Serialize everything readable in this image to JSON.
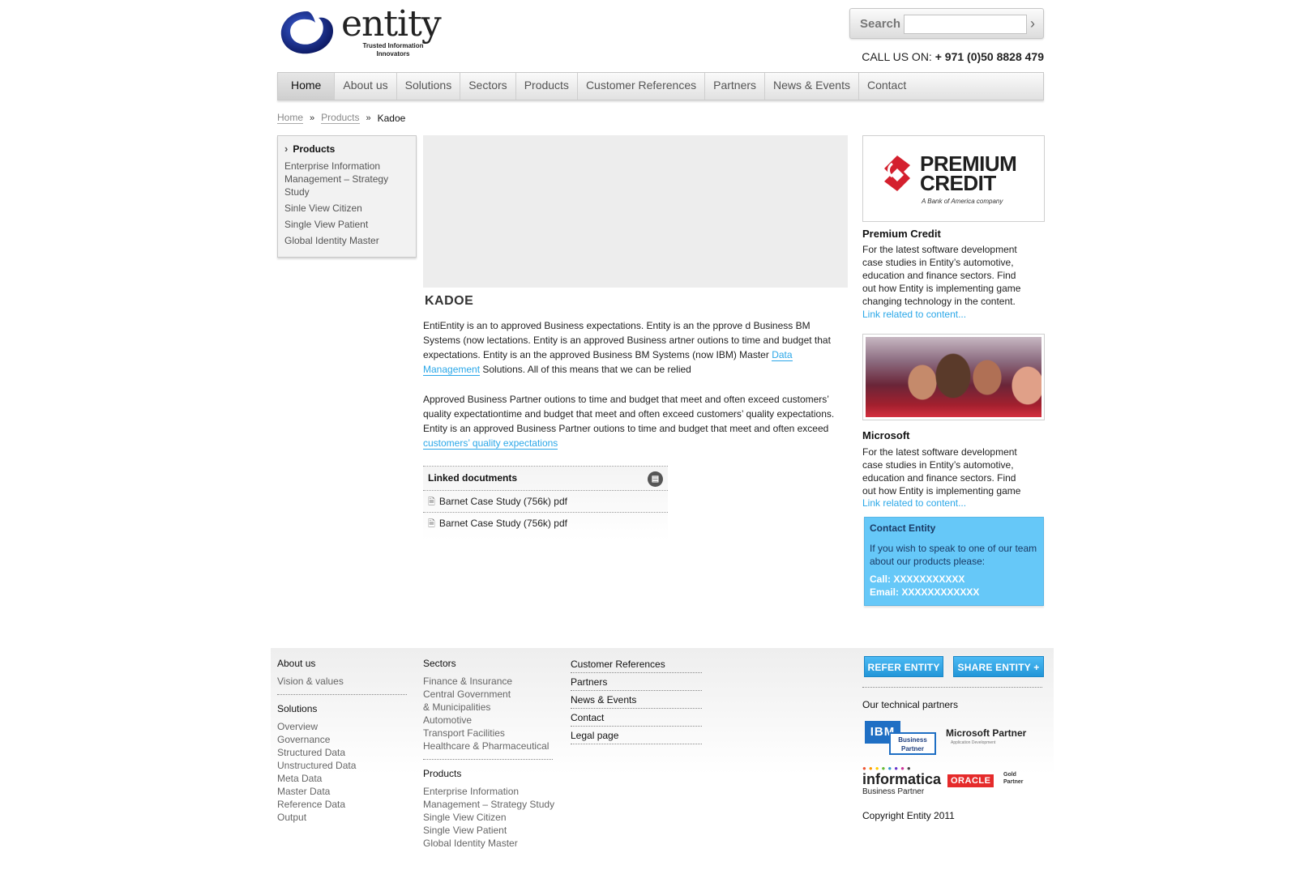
{
  "header": {
    "logo_word": "entity",
    "logo_tagline": "Trusted Information Innovators",
    "search_label": "Search",
    "search_placeholder": "",
    "call_prefix": "CALL US ON:",
    "call_number": "+ 971 (0)50 8828 479"
  },
  "nav": {
    "items": [
      "Home",
      "About us",
      "Solutions",
      "Sectors",
      "Products",
      "Customer References",
      "Partners",
      "News & Events",
      "Contact"
    ],
    "active": "Home"
  },
  "breadcrumb": {
    "home": "Home",
    "products": "Products",
    "current": "Kadoe"
  },
  "sidebar": {
    "title": "Products",
    "items": [
      "Enterprise Information Management – Strategy Study",
      "Sinle View Citizen",
      "Single View Patient",
      "Global Identity Master"
    ]
  },
  "main": {
    "title": "KADOE",
    "para1_a": "EntiEntity is an to  approved Business expectations. Entity is an the  pprove d Business BM Systems (now lectations. Entity is an  approved Business artner outions to time and budget that expectations. Entity is an the  approved Business BM Systems (now IBM) Master ",
    "para1_link": "Data Management",
    "para1_b": " Solutions. All of this means that we can be relied",
    "para2_a": "Approved Business Partner outions to time and budget that meet and often exceed customers’ quality expectationtime and budget that meet and often exceed customers’ quality expectations. Entity is an  approved Business Partner outions to time and budget that meet and often exceed ",
    "para2_link": "customers’ quality expectations",
    "docs_title": "Linked docutments",
    "docs": [
      "Barnet Case Study (756k) pdf",
      "Barnet Case Study (756k) pdf"
    ]
  },
  "right": {
    "pc_logo_line1": "PREMIUM",
    "pc_logo_line2": "CREDIT",
    "pc_logo_sub": "A Bank of America company",
    "card1_title": "Premium Credit",
    "card1_text": "For the latest software development case studies in Entity’s automotive, education and finance sectors. Find out how Entity is implementing game changing technology in the content.",
    "card1_link": "Link related to content...",
    "card2_title": "Microsoft",
    "card2_text": "For the latest software development case studies in Entity’s automotive, education and finance sectors. Find out how Entity is implementing game",
    "card2_link": "Link related to content...",
    "contact_title": "Contact Entity",
    "contact_text": "If you wish to speak to one of our team about our products please:",
    "contact_call": "Call: XXXXXXXXXXX",
    "contact_email": "Email: XXXXXXXXXXXX"
  },
  "footer": {
    "about_head": "About us",
    "about_links": [
      "Vision & values"
    ],
    "solutions_head": "Solutions",
    "solutions_links": [
      "Overview",
      "Governance",
      "Structured Data",
      "Unstructured Data",
      "Meta Data",
      "Master Data",
      "Reference Data",
      "Output"
    ],
    "sectors_head": "Sectors",
    "sectors_links": [
      "Finance & Insurance",
      "Central Government",
      "& Municipalities",
      "Automotive",
      "Transport Facilities",
      "Healthcare & Pharmaceutical"
    ],
    "products_head": "Products",
    "products_links": [
      "Enterprise Information",
      "Management – Strategy Study",
      "Single View Citizen",
      "Single View Patient",
      "Global Identity Master"
    ],
    "col3_items": [
      "Customer References",
      "Partners",
      "News & Events",
      "Contact",
      "Legal page"
    ],
    "refer_btn": "REFER ENTITY",
    "share_btn": "SHARE ENTITY +",
    "partners_label": "Our technical partners",
    "ibm_text": "IBM",
    "ibm_bp": "Business Partner",
    "ms_partner": "Microsoft Partner",
    "ms_partner_sub": "Application Development",
    "informatica": "informatica",
    "informatica_sub": "Business Partner",
    "oracle": "ORACLE",
    "oracle_gold": "Gold Partner",
    "copyright": "Copyright Entity 2011"
  },
  "colors": {
    "accent": "#2aa7e8",
    "contact_bg": "#66c8f8",
    "logo_blue": "#1b2f8f"
  }
}
